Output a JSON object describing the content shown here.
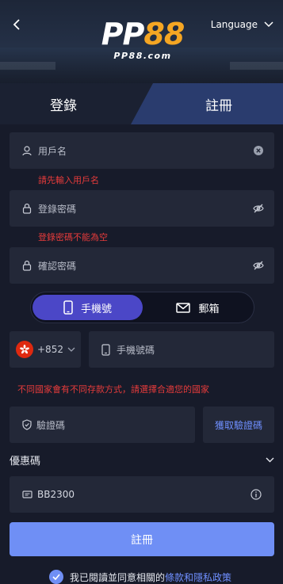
{
  "header": {
    "logo_main": "PP",
    "logo_accent": "88",
    "logo_sub": "PP88.com",
    "language_label": "Language"
  },
  "tabs": {
    "login": "登錄",
    "register": "註冊"
  },
  "form": {
    "username_placeholder": "用戶名",
    "username_error": "請先輸入用戶名",
    "password_placeholder": "登錄密碼",
    "password_error": "登錄密碼不能為空",
    "confirm_placeholder": "確認密碼"
  },
  "method": {
    "phone_label": "手機號",
    "email_label": "郵箱",
    "active": "phone"
  },
  "phone": {
    "country_code": "+852",
    "placeholder": "手機號碼",
    "notice": "不同國家會有不同存款方式，請選擇合適您的國家"
  },
  "verify": {
    "placeholder": "驗證碼",
    "get_code_label": "獲取驗證碼"
  },
  "promo": {
    "label": "優惠碼",
    "value": "BB2300"
  },
  "submit_label": "註冊",
  "terms": {
    "prefix": "我已閱讀並同意相關的",
    "link": "條款和隱私政策",
    "checked": true
  },
  "colors": {
    "background": "#171b2a",
    "field": "#232838",
    "accent": "#6f8ff5",
    "active_toggle": "#4b47c7",
    "error": "#e53b3b",
    "logo_accent": "#f5a623"
  }
}
